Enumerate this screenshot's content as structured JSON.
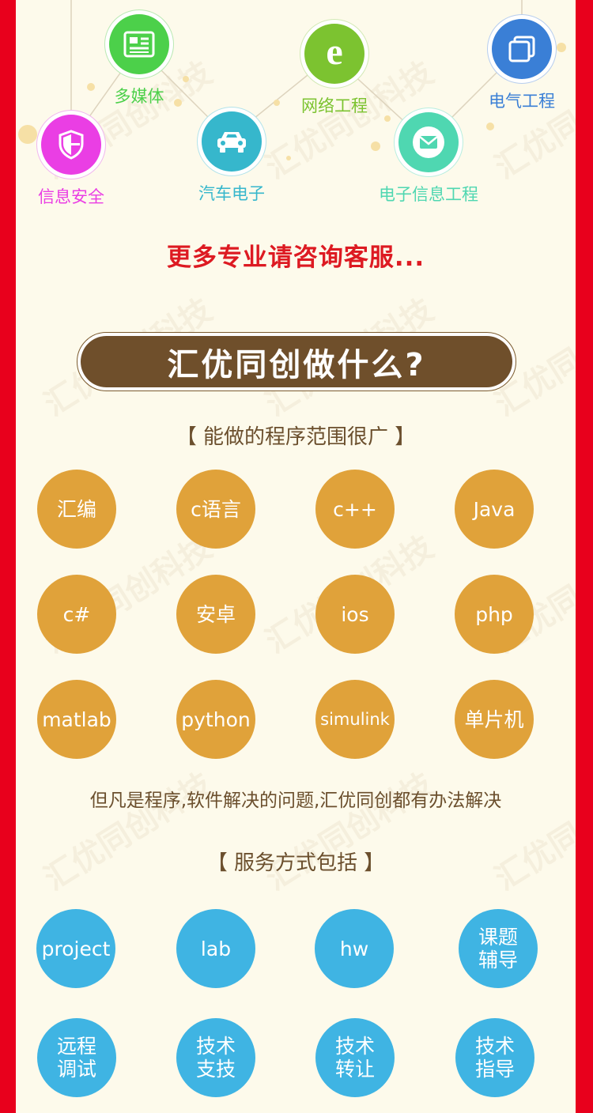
{
  "nodes": [
    {
      "label": "多媒体",
      "icon": "newspaper-icon",
      "color": "#4cd04a",
      "name": "node-multimedia"
    },
    {
      "label": "网络工程",
      "icon": "ie-browser-icon",
      "color": "#7cc330",
      "name": "node-network-engineering"
    },
    {
      "label": "电气工程",
      "icon": "windows-icon",
      "color": "#3a7fd6",
      "name": "node-electrical-engineering"
    },
    {
      "label": "信息安全",
      "icon": "shield-icon",
      "color": "#ea3ee4",
      "name": "node-information-security"
    },
    {
      "label": "汽车电子",
      "icon": "car-icon",
      "color": "#36b7cc",
      "name": "node-automotive-electronics"
    },
    {
      "label": "电子信息工程",
      "icon": "mail-icon",
      "color": "#4fd7b1",
      "name": "node-electronic-information"
    }
  ],
  "more_text": "更多专业请咨询客服...",
  "banner_title": "汇优同创做什么?",
  "programs_heading": "【 能做的程序范围很广 】",
  "programs": [
    "汇编",
    "c语言",
    "c++",
    "Java",
    "c#",
    "安卓",
    "ios",
    "php",
    "matlab",
    "python",
    "simulink",
    "单片机"
  ],
  "programs_note": "但凡是程序,软件解决的问题,汇优同创都有办法解决",
  "services_heading": "【 服务方式包括 】",
  "services": [
    "project",
    "lab",
    "hw",
    "课题\n辅导",
    "远程\n调试",
    "技术\n支技",
    "技术\n转让",
    "技术\n指导"
  ],
  "watermark": "汇优同创科技",
  "colors": {
    "frame": "#e8001c",
    "background": "#fdfaeb",
    "title_red": "#dd1a22",
    "banner_brown": "#6f4f2b",
    "orange": "#e0a23a",
    "blue": "#3fb4e3",
    "text_brown": "#6b4f2d"
  }
}
